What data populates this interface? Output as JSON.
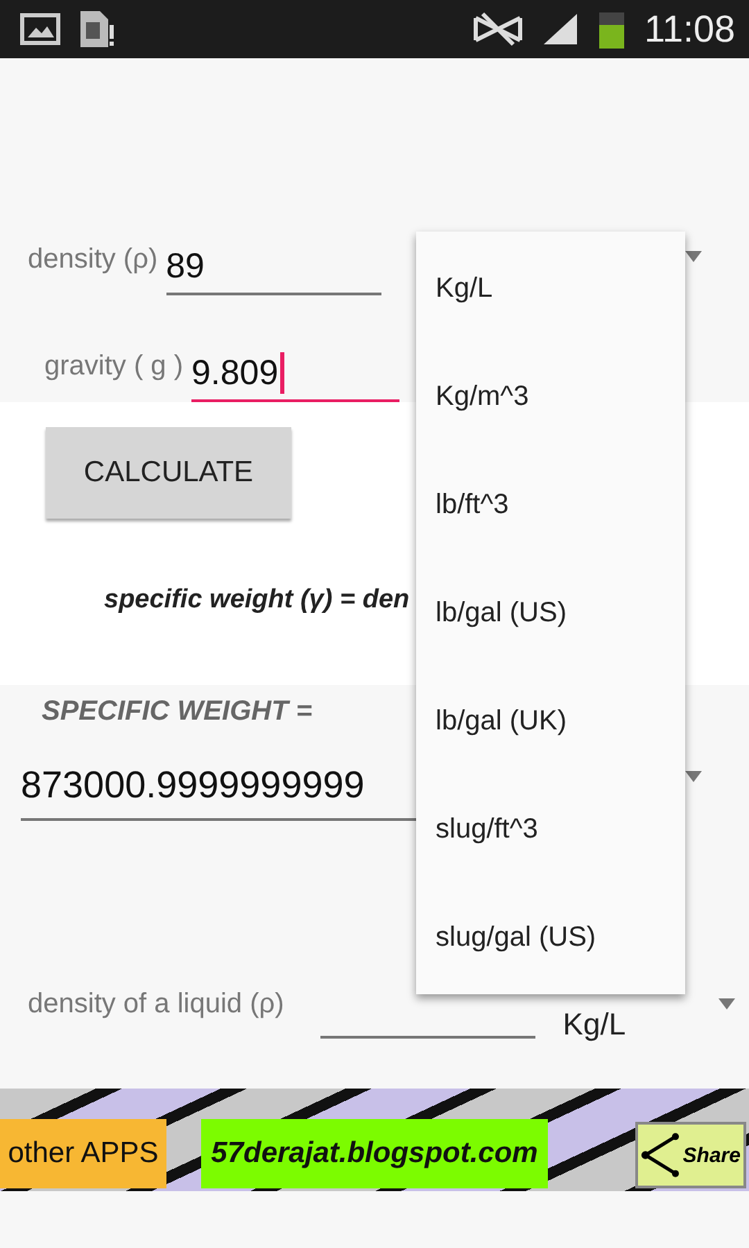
{
  "status_bar": {
    "time": "11:08"
  },
  "inputs": [
    {
      "label": "density (ρ)",
      "value": "89",
      "focused": false
    },
    {
      "label": "gravity ( g )",
      "value": "9.809",
      "focused": true
    }
  ],
  "calculate_button": "CALCULATE",
  "formula": "specific weight (γ) = den",
  "result": {
    "label": "SPECIFIC WEIGHT =",
    "value": "873000.9999999999"
  },
  "liquid": {
    "label": "density of a liquid (ρ)",
    "unit": "Kg/L"
  },
  "dropdown": {
    "options": [
      "Kg/L",
      "Kg/m^3",
      "lb/ft^3",
      "lb/gal (US)",
      "lb/gal (UK)",
      "slug/ft^3",
      "slug/gal (US)"
    ]
  },
  "banner": {
    "other_apps": "other APPS",
    "site": "57derajat.blogspot.com",
    "share": "Share"
  }
}
